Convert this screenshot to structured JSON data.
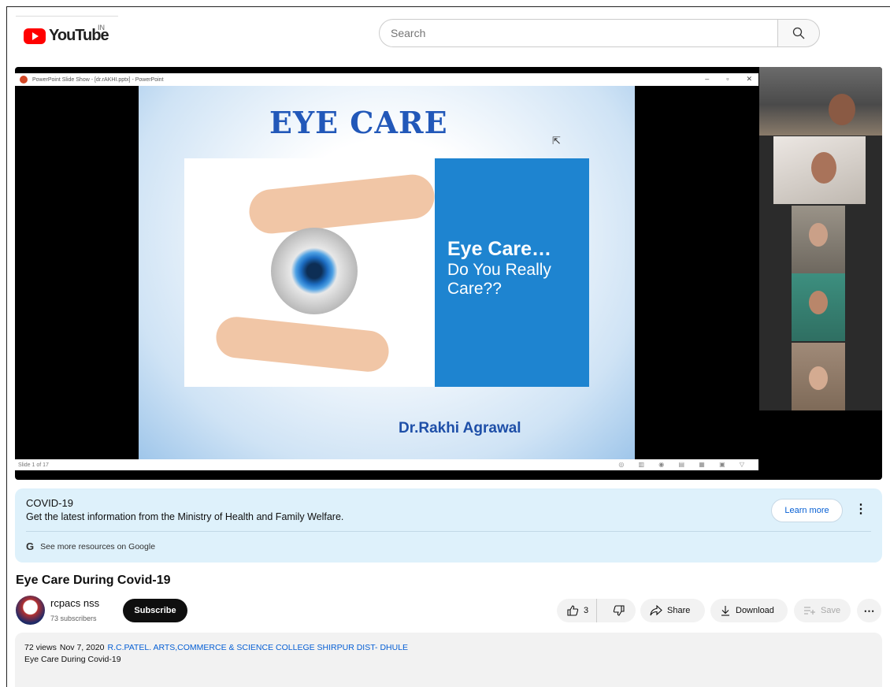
{
  "header": {
    "logo_text": "YouTube",
    "region": "IN",
    "search_placeholder": "Search"
  },
  "player": {
    "pp_window_title": "PowerPoint Slide Show - [dr.rAKHI.pptx] - PowerPoint",
    "pp_window_buttons": [
      "–",
      "▫",
      "✕"
    ],
    "slide_title": "EYE CARE",
    "slide_box_bold": "Eye Care…",
    "slide_box_rest": "Do You Really Care??",
    "slide_author": "Dr.Rakhi Agrawal",
    "pp_status": "Slide 1 of 17",
    "pp_status_icons": "◎ ▥ ◉ ▤ ▦ ▣ ▽"
  },
  "covid": {
    "title": "COVID-19",
    "description": "Get the latest information from the Ministry of Health and Family Welfare.",
    "google_label": "See more resources on Google",
    "learn_more": "Learn more"
  },
  "video": {
    "title": "Eye Care During Covid-19",
    "channel_name": "rcpacs nss",
    "subscribers": "73 subscribers",
    "subscribe_label": "Subscribe",
    "likes": "3",
    "share_label": "Share",
    "download_label": "Download",
    "save_label": "Save"
  },
  "description": {
    "views": "72 views",
    "date": "Nov 7, 2020",
    "link": "R.C.PATEL. ARTS,COMMERCE & SCIENCE COLLEGE SHIRPUR DIST- DHULE",
    "text": "Eye Care During Covid-19"
  },
  "colors": {
    "brand_red": "#ff0000",
    "link_blue": "#065fd4",
    "banner_bg": "#def1fb",
    "slide_box": "#1e84d0",
    "slide_title": "#2258b9"
  }
}
